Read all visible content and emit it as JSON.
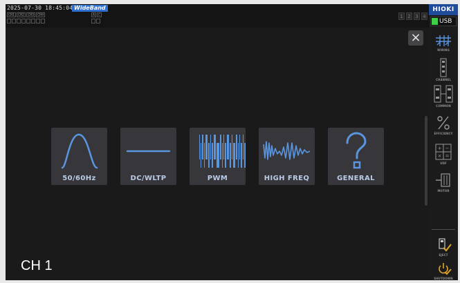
{
  "status_bar": {
    "datetime": "2025-07-30 18:45:04",
    "mode": "WideBand",
    "channel_labels": [
      "CH1",
      "CH2",
      "CH3",
      "CH4"
    ],
    "extra_labels": [
      "A",
      "C"
    ],
    "pages": [
      "1",
      "2",
      "3",
      "4"
    ]
  },
  "dialog": {
    "close_glyph": "×",
    "channel_title": "CH 1",
    "wave_buttons": [
      {
        "label": "50/60Hz",
        "icon": "sine-wave-icon"
      },
      {
        "label": "DC/WLTP",
        "icon": "dc-line-icon"
      },
      {
        "label": "PWM",
        "icon": "pwm-wave-icon"
      },
      {
        "label": "HIGH FREQ",
        "icon": "high-freq-wave-icon"
      },
      {
        "label": "GENERAL",
        "icon": "question-mark-icon"
      }
    ]
  },
  "sidebar": {
    "brand": "HIOKI",
    "usb_label": "USB",
    "items": [
      {
        "label": "WIRING",
        "icon": "wiring-icon",
        "active": true
      },
      {
        "label": "CHANNEL",
        "icon": "channel-icon"
      },
      {
        "label": "COMMON",
        "icon": "common-icon"
      },
      {
        "label": "EFFICIENCY",
        "icon": "efficiency-icon"
      },
      {
        "label": "UDF",
        "icon": "udf-icon"
      },
      {
        "label": "MOTOR",
        "icon": "motor-icon"
      }
    ],
    "bottom_items": [
      {
        "label": "EJECT",
        "icon": "eject-icon"
      },
      {
        "label": "SHUTDOWN",
        "icon": "shutdown-icon"
      }
    ]
  },
  "colors": {
    "accent": "#5a95e0",
    "brand": "#1f4c9a",
    "badge": "#2f6fd0",
    "usb_led": "#3fd04a",
    "bottom_icon": "#e0a52a"
  }
}
